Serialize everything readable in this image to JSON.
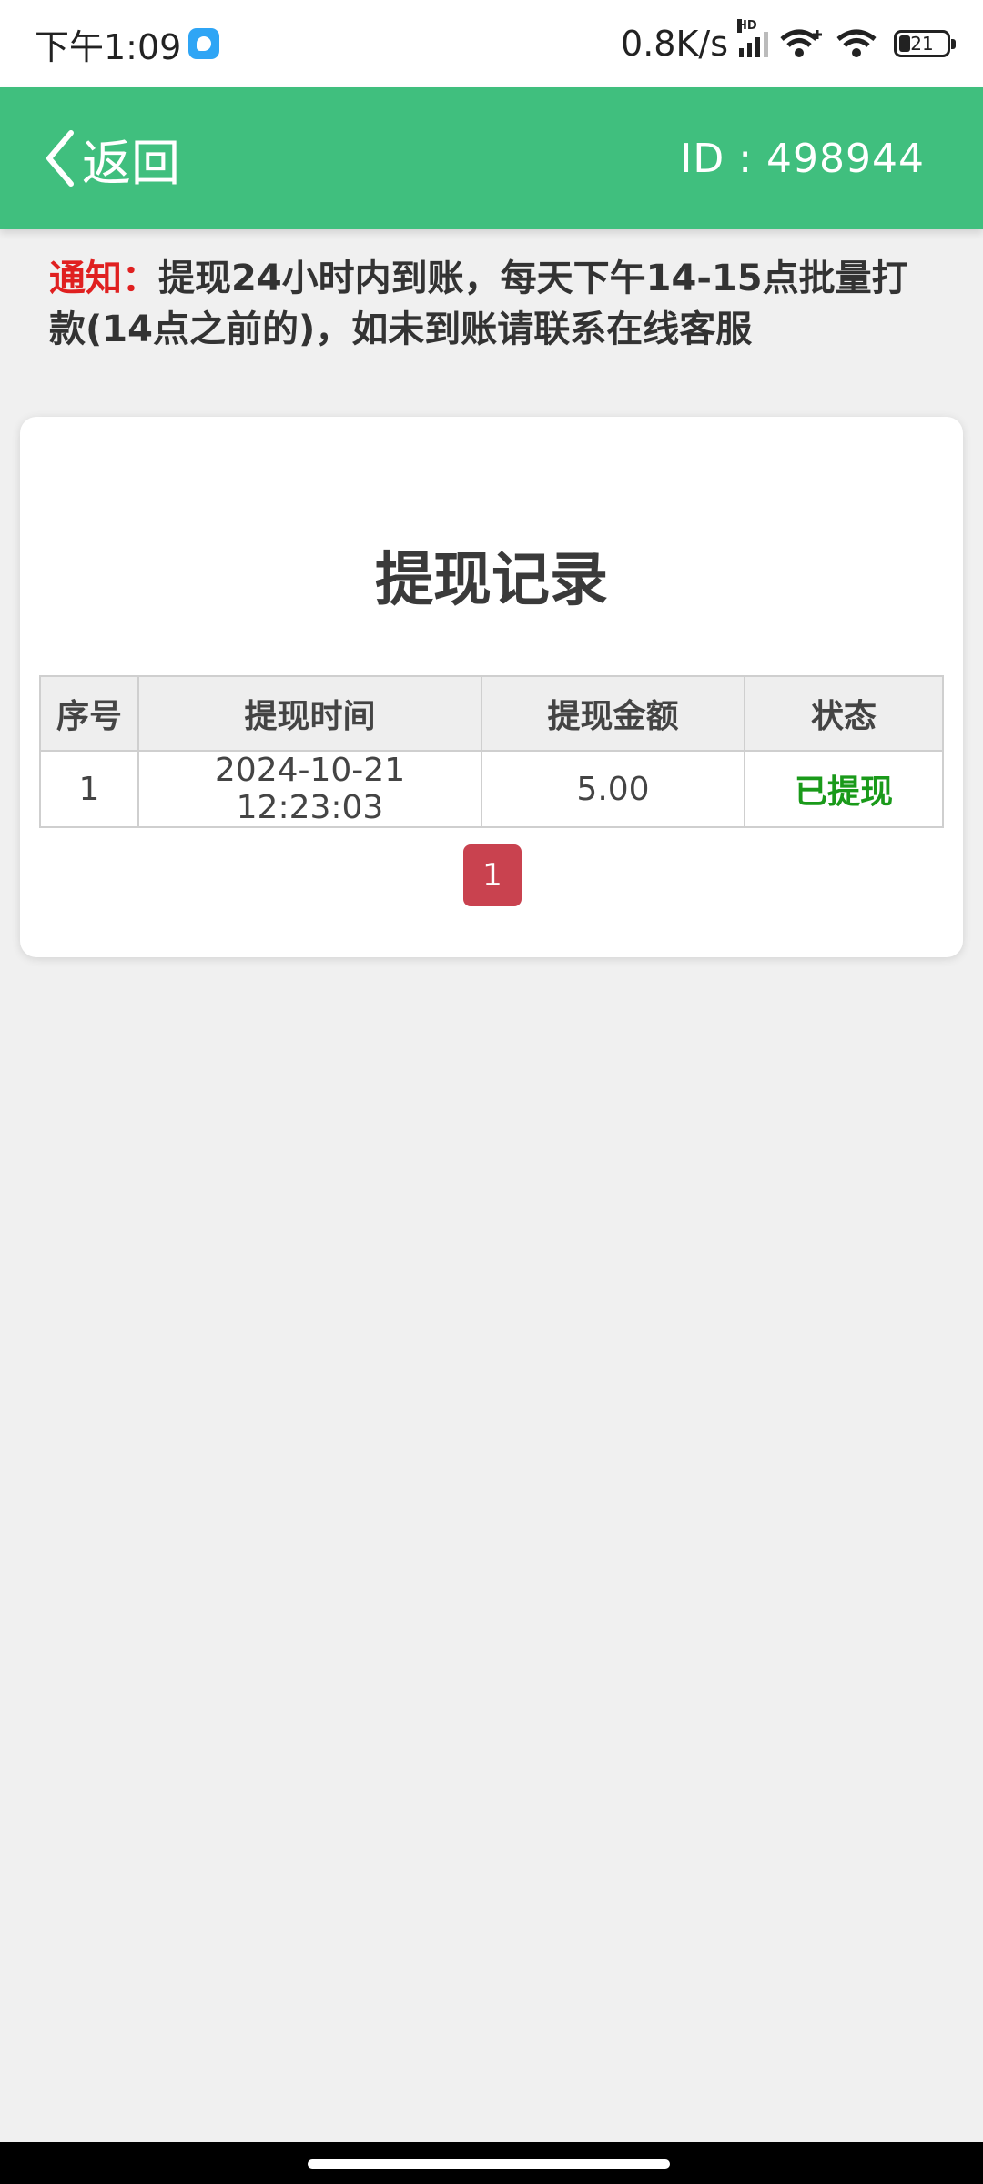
{
  "status_bar": {
    "time": "下午1:09",
    "network_speed": "0.8K/s",
    "network_type": "HD",
    "battery": "21",
    "icons": [
      "app-notification-icon",
      "signal-icon",
      "wifi-plus-icon",
      "wifi-icon",
      "battery-icon"
    ]
  },
  "header": {
    "back_label": "返回",
    "user_id": "ID : 498944",
    "background_color": "#40bf7e"
  },
  "notice": {
    "label": "通知：",
    "text": "提现24小时内到账，每天下午14-15点批量打款(14点之前的)，如未到账请联系在线客服",
    "label_color": "#e02020"
  },
  "records": {
    "title": "提现记录",
    "columns": [
      "序号",
      "提现时间",
      "提现金额",
      "状态"
    ],
    "rows": [
      {
        "index": "1",
        "time": "2024-10-21 12:23:03",
        "amount": "5.00",
        "status": "已提现"
      }
    ],
    "status_color": "#1a9a1a"
  },
  "pagination": {
    "current_page": "1",
    "accent_color": "#c9424f"
  }
}
